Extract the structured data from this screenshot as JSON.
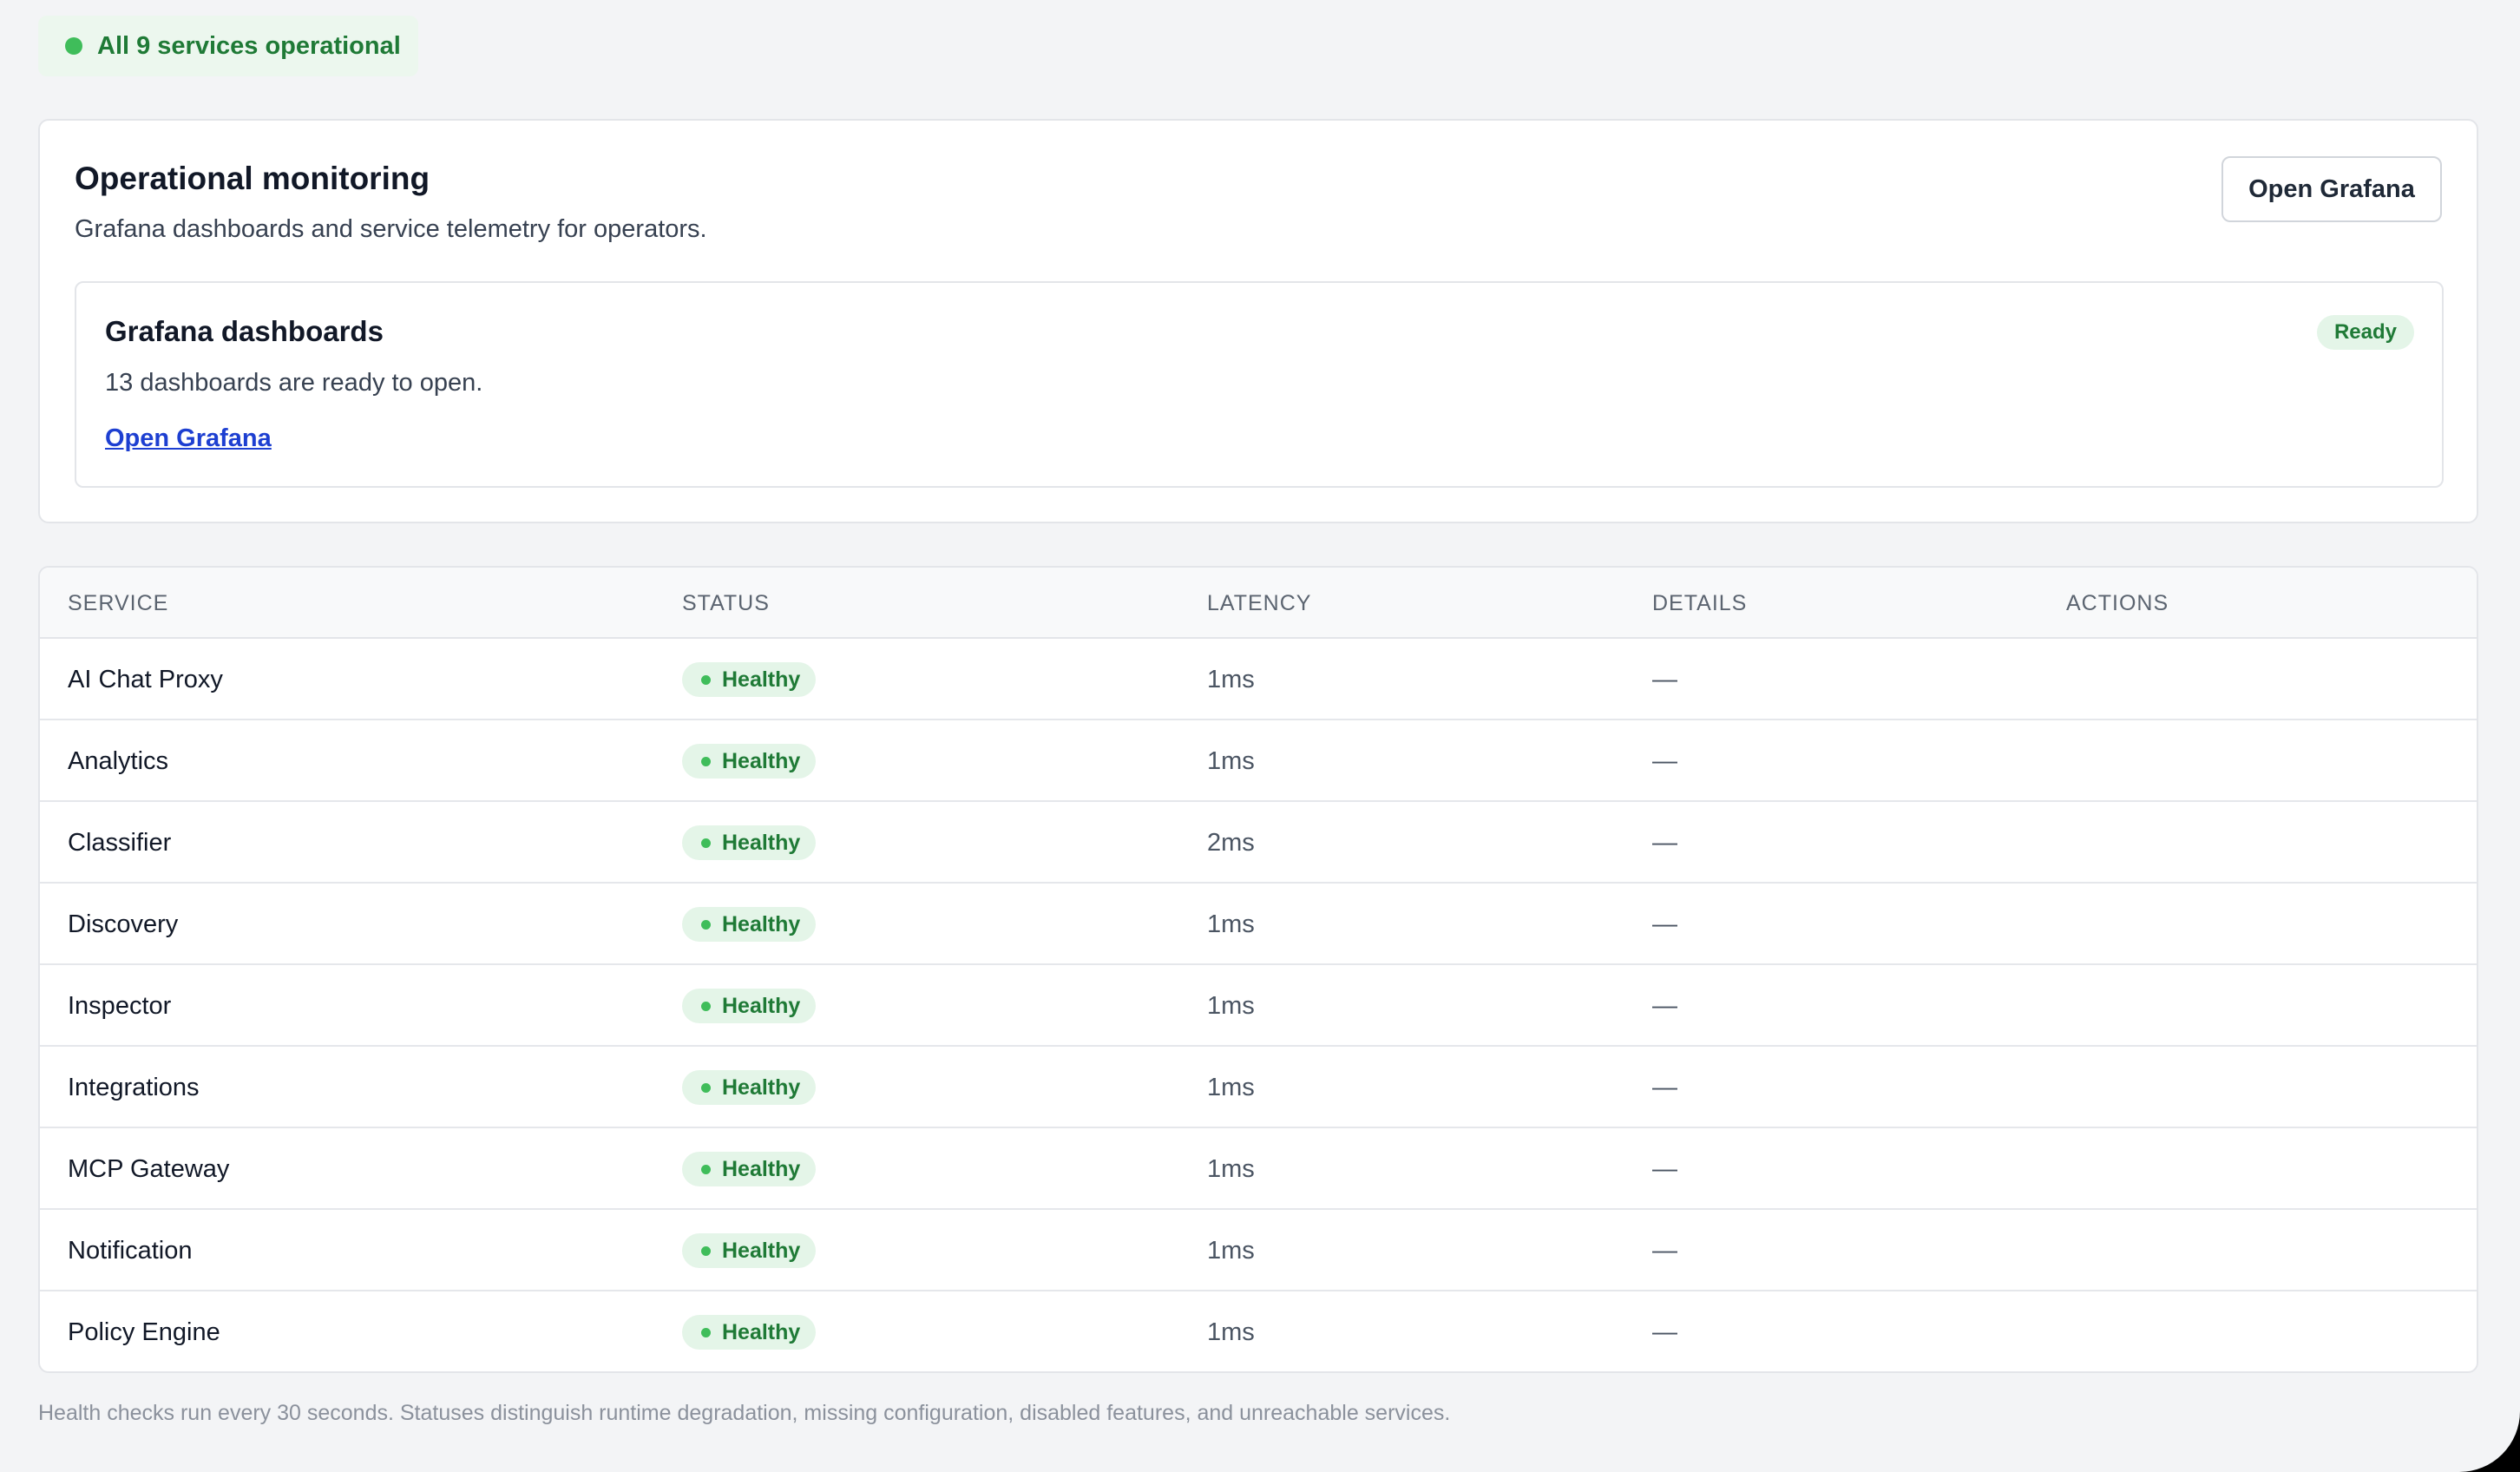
{
  "status_banner": {
    "text": "All 9 services operational",
    "color": "#3fbd5a"
  },
  "monitoring": {
    "title": "Operational monitoring",
    "subtitle": "Grafana dashboards and service telemetry for operators.",
    "open_button_label": "Open Grafana",
    "dashboards_card": {
      "title": "Grafana dashboards",
      "description": "13 dashboards are ready to open.",
      "link_label": "Open Grafana",
      "badge": "Ready"
    }
  },
  "table": {
    "columns": [
      "SERVICE",
      "STATUS",
      "LATENCY",
      "DETAILS",
      "ACTIONS"
    ],
    "rows": [
      {
        "service": "AI Chat Proxy",
        "status": "Healthy",
        "latency": "1ms",
        "details": "—",
        "actions": ""
      },
      {
        "service": "Analytics",
        "status": "Healthy",
        "latency": "1ms",
        "details": "—",
        "actions": ""
      },
      {
        "service": "Classifier",
        "status": "Healthy",
        "latency": "2ms",
        "details": "—",
        "actions": ""
      },
      {
        "service": "Discovery",
        "status": "Healthy",
        "latency": "1ms",
        "details": "—",
        "actions": ""
      },
      {
        "service": "Inspector",
        "status": "Healthy",
        "latency": "1ms",
        "details": "—",
        "actions": ""
      },
      {
        "service": "Integrations",
        "status": "Healthy",
        "latency": "1ms",
        "details": "—",
        "actions": ""
      },
      {
        "service": "MCP Gateway",
        "status": "Healthy",
        "latency": "1ms",
        "details": "—",
        "actions": ""
      },
      {
        "service": "Notification",
        "status": "Healthy",
        "latency": "1ms",
        "details": "—",
        "actions": ""
      },
      {
        "service": "Policy Engine",
        "status": "Healthy",
        "latency": "1ms",
        "details": "—",
        "actions": ""
      }
    ]
  },
  "footnote": "Health checks run every 30 seconds. Statuses distinguish runtime degradation, missing configuration, disabled features, and unreachable services.",
  "colors": {
    "healthy_text": "#1f7a36",
    "healthy_bg": "#e4f5e8",
    "link": "#1d3fd1"
  }
}
